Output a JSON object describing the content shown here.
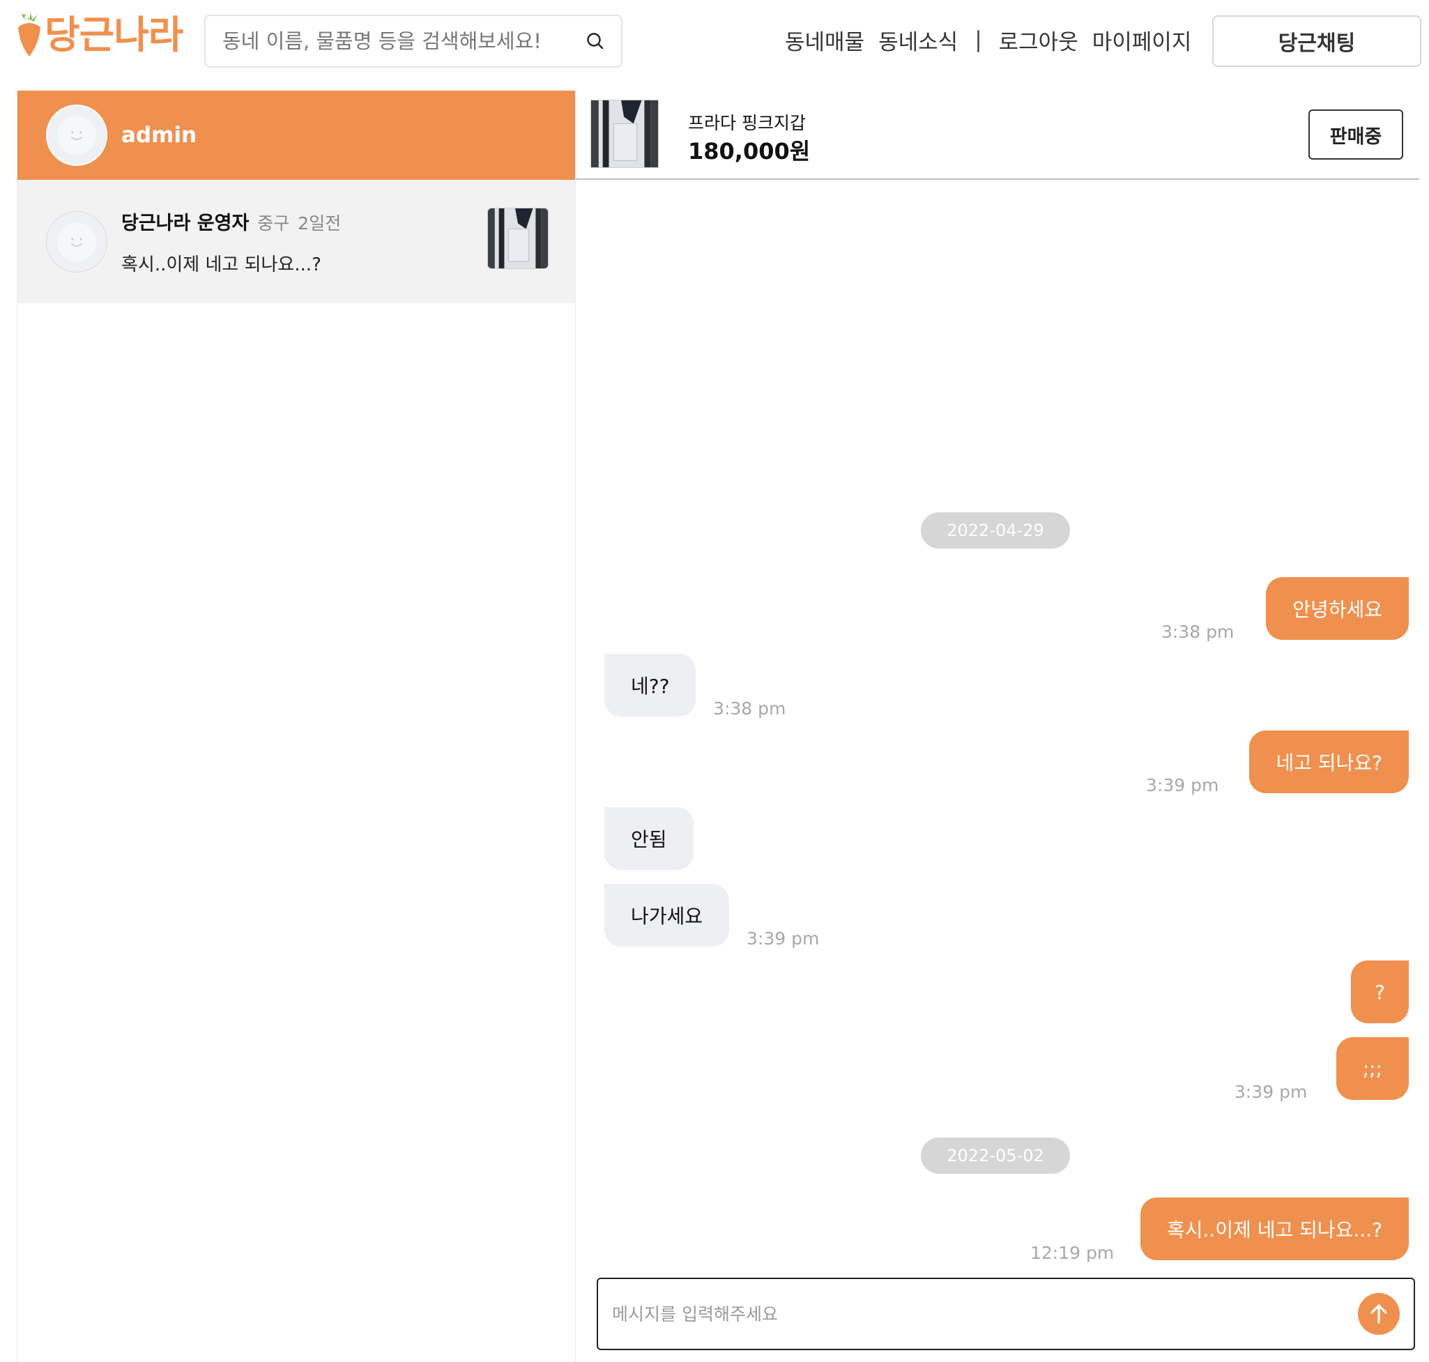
{
  "header": {
    "logo_text": "당근나라",
    "search_placeholder": "동네 이름, 물품명 등을 검색해보세요!",
    "nav": {
      "local_listings": "동네매물",
      "local_news": "동네소식",
      "separator": "|",
      "logout": "로그아웃",
      "mypage": "마이페이지"
    },
    "chat_button": "당근채팅"
  },
  "sidebar": {
    "current_user": "admin",
    "chats": [
      {
        "name": "당근나라 운영자",
        "location": "중구",
        "time": "2일전",
        "last_message": "혹시..이제 네고 되나요...?"
      }
    ]
  },
  "product": {
    "title": "프라다 핑크지갑",
    "price": "180,000원",
    "status": "판매중"
  },
  "messages": {
    "date1": "2022-04-29",
    "m1": {
      "text": "안녕하세요",
      "time": "3:38 pm"
    },
    "m2": {
      "text": "네??",
      "time": "3:38 pm"
    },
    "m3": {
      "text": "네고 되나요?",
      "time": "3:39 pm"
    },
    "m4": {
      "text": "안됨"
    },
    "m5": {
      "text": "나가세요",
      "time": "3:39 pm"
    },
    "m6": {
      "text": "?"
    },
    "m7": {
      "text": ";;;",
      "time": "3:39 pm"
    },
    "date2": "2022-05-02",
    "m8": {
      "text": "혹시..이제 네고 되나요...?",
      "time": "12:19 pm"
    }
  },
  "composer": {
    "placeholder": "메시지를 입력해주세요"
  },
  "colors": {
    "accent": "#f0904e",
    "incoming_bubble": "#eeeff2",
    "date_pill": "#d6d6d6"
  }
}
